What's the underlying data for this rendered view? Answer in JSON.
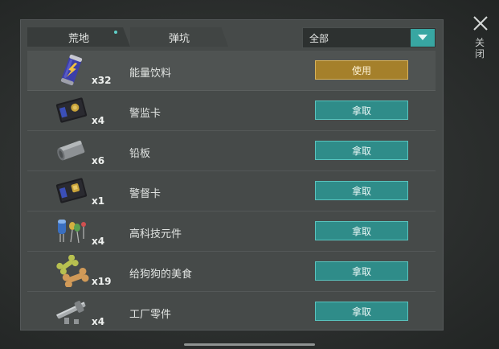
{
  "tabs": [
    {
      "label": "荒地"
    },
    {
      "label": "弹坑"
    }
  ],
  "filter": {
    "selected": "全部"
  },
  "close_label": "关闭",
  "items": [
    {
      "name": "能量饮料",
      "qty": "x32",
      "action": "使用",
      "icon": "energy-drink-icon"
    },
    {
      "name": "警监卡",
      "qty": "x4",
      "action": "拿取",
      "icon": "police-card-icon"
    },
    {
      "name": "铅板",
      "qty": "x6",
      "action": "拿取",
      "icon": "lead-plate-icon"
    },
    {
      "name": "警督卡",
      "qty": "x1",
      "action": "拿取",
      "icon": "police-card-icon"
    },
    {
      "name": "高科技元件",
      "qty": "x4",
      "action": "拿取",
      "icon": "hitech-components-icon"
    },
    {
      "name": "给狗狗的美食",
      "qty": "x19",
      "action": "拿取",
      "icon": "dog-treat-icon"
    },
    {
      "name": "工厂零件",
      "qty": "x4",
      "action": "拿取",
      "icon": "factory-parts-icon"
    }
  ],
  "colors": {
    "accent": "#38a6a2",
    "use_button": "#a5802b",
    "panel": "#464a49"
  }
}
